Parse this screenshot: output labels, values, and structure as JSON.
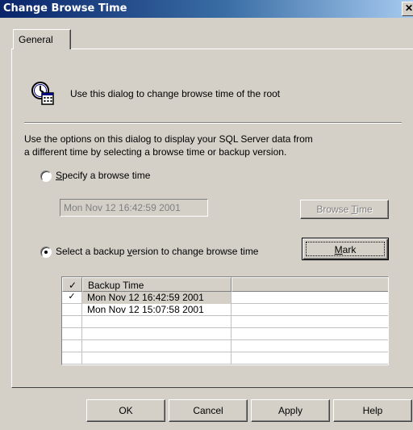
{
  "window": {
    "title": "Change Browse Time",
    "close_glyph": "✕"
  },
  "tabs": [
    {
      "label": "General",
      "selected": true
    }
  ],
  "info": {
    "icon": "clock-calendar-icon",
    "text": "Use this dialog to change browse time of the root"
  },
  "description": {
    "line1": "Use the options on this dialog to display your SQL Server data from",
    "line2": "a different time by selecting a browse time or backup version."
  },
  "options": {
    "specify": {
      "label_prefix": "",
      "label_access": "S",
      "label_rest": "pecify a browse time",
      "selected": false
    },
    "backup": {
      "label_prefix": "Select a backup ",
      "label_access": "v",
      "label_rest": "ersion to change browse time",
      "selected": true
    }
  },
  "browse_time_value": "Mon Nov 12 16:42:59 2001",
  "buttons": {
    "browse_time": {
      "prefix": "Browse ",
      "access": "T",
      "rest": "ime",
      "enabled": false
    },
    "mark": {
      "access": "M",
      "rest": "ark"
    },
    "ok": "OK",
    "cancel": "Cancel",
    "apply": "Apply",
    "help": "Help"
  },
  "table": {
    "columns": [
      "✓",
      "Backup Time",
      ""
    ],
    "rows": [
      {
        "checked": true,
        "check_glyph": "✓",
        "time": "Mon Nov 12 16:42:59 2001",
        "selected": true
      },
      {
        "checked": false,
        "check_glyph": "",
        "time": "Mon Nov 12 15:07:58 2001",
        "selected": false
      }
    ]
  },
  "colors": {
    "face": "#d4d0c8",
    "title_start": "#0a246a",
    "title_end": "#a6caf0",
    "disabled_text": "#808080"
  }
}
